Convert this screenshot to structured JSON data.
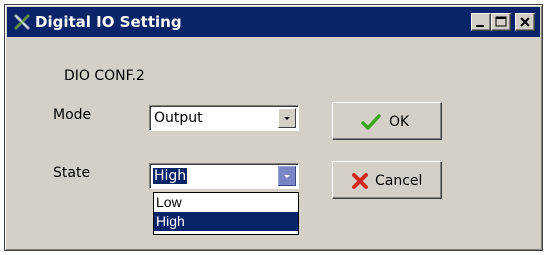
{
  "window": {
    "title": "Digital IO Setting",
    "icon": "crossed-tools-icon",
    "controls": {
      "minimize": "minimize-icon",
      "maximize": "maximize-icon",
      "close": "close-icon"
    }
  },
  "form": {
    "heading": "DIO CONF.2",
    "mode_label": "Mode",
    "mode_value": "Output",
    "state_label": "State",
    "state_value": "High",
    "state_options": [
      "Low",
      "High"
    ],
    "state_highlighted": "High"
  },
  "buttons": {
    "ok_label": "OK",
    "ok_icon": "checkmark-icon",
    "cancel_label": "Cancel",
    "cancel_icon": "x-mark-icon"
  },
  "colors": {
    "titlebar": "#0a246a",
    "face": "#d4d0c8",
    "selection": "#0a246a",
    "ok_check": "#3aa61c",
    "cancel_x": "#d2281e"
  }
}
